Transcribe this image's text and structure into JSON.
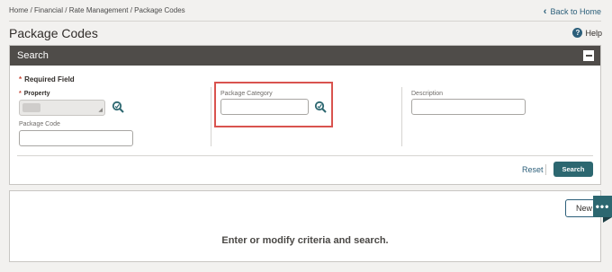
{
  "breadcrumb": "Home / Financial / Rate Management / Package Codes",
  "back_label": "Back to Home",
  "page_title": "Package Codes",
  "help_label": "Help",
  "search_panel": {
    "title": "Search",
    "required_note": "Required Field",
    "fields": {
      "property_label": "Property",
      "package_code_label": "Package Code",
      "package_category_label": "Package Category",
      "description_label": "Description"
    },
    "reset_label": "Reset",
    "search_label": "Search"
  },
  "results": {
    "new_label": "New",
    "more_label": "•••",
    "empty_message": "Enter or modify criteria and search."
  },
  "colors": {
    "accent": "#2c6770",
    "link": "#2c5f7a",
    "required": "#c74634",
    "highlight": "#d9534f",
    "header": "#4f4c49"
  },
  "icons": [
    "chevron-left-icon",
    "help-icon",
    "collapse-icon",
    "lookup-icon"
  ]
}
